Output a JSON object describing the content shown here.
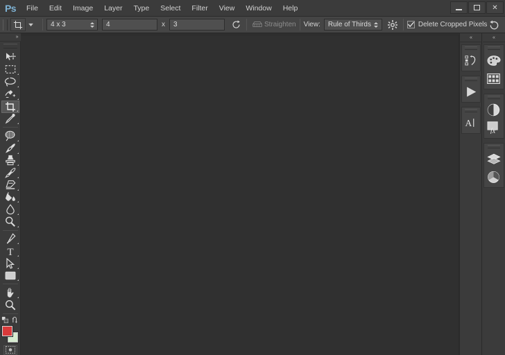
{
  "app": {
    "name": "Adobe Photoshop",
    "logo_text": "Ps"
  },
  "menubar": {
    "items": [
      {
        "label": "File",
        "name": "menu-file"
      },
      {
        "label": "Edit",
        "name": "menu-edit"
      },
      {
        "label": "Image",
        "name": "menu-image"
      },
      {
        "label": "Layer",
        "name": "menu-layer"
      },
      {
        "label": "Type",
        "name": "menu-type"
      },
      {
        "label": "Select",
        "name": "menu-select"
      },
      {
        "label": "Filter",
        "name": "menu-filter"
      },
      {
        "label": "View",
        "name": "menu-view"
      },
      {
        "label": "Window",
        "name": "menu-window"
      },
      {
        "label": "Help",
        "name": "menu-help"
      }
    ]
  },
  "window_controls": {
    "minimize": "minimize-button",
    "maximize": "maximize-button",
    "close_label": "✕"
  },
  "options_bar": {
    "tool": "crop-tool",
    "ratio_preset": "4 x 3",
    "width_value": "4",
    "separator_label": "x",
    "height_value": "3",
    "swap_icon": "swap-dimensions-icon",
    "straighten_label": "Straighten",
    "straighten_icon": "straighten-icon",
    "view_label": "View:",
    "overlay_value": "Rule of Thirds",
    "settings_icon": "gear-icon",
    "delete_cropped_label": "Delete Cropped Pixels",
    "delete_cropped_checked": true,
    "reset_icon": "reset-icon"
  },
  "toolbar": {
    "collapse_glyph": "»",
    "active_tool": "crop-tool",
    "groups": [
      {
        "tools": [
          {
            "name": "move-tool",
            "has_flyout": false
          },
          {
            "name": "rectangular-marquee-tool",
            "has_flyout": true
          },
          {
            "name": "lasso-tool",
            "has_flyout": true
          },
          {
            "name": "quick-selection-tool",
            "has_flyout": true
          },
          {
            "name": "crop-tool",
            "has_flyout": true,
            "active": true
          },
          {
            "name": "eyedropper-tool",
            "has_flyout": true
          }
        ]
      },
      {
        "tools": [
          {
            "name": "spot-healing-brush-tool",
            "has_flyout": true
          },
          {
            "name": "brush-tool",
            "has_flyout": true
          },
          {
            "name": "clone-stamp-tool",
            "has_flyout": true
          },
          {
            "name": "history-brush-tool",
            "has_flyout": true
          },
          {
            "name": "eraser-tool",
            "has_flyout": true
          },
          {
            "name": "gradient-tool",
            "has_flyout": true
          },
          {
            "name": "blur-tool",
            "has_flyout": true
          },
          {
            "name": "dodge-tool",
            "has_flyout": true
          }
        ]
      },
      {
        "tools": [
          {
            "name": "pen-tool",
            "has_flyout": true
          },
          {
            "name": "horizontal-type-tool",
            "has_flyout": true
          },
          {
            "name": "path-selection-tool",
            "has_flyout": true
          },
          {
            "name": "rectangle-tool",
            "has_flyout": true
          }
        ]
      },
      {
        "tools": [
          {
            "name": "hand-tool",
            "has_flyout": true
          },
          {
            "name": "zoom-tool",
            "has_flyout": false
          }
        ]
      }
    ],
    "color_controls": {
      "default_colors_icon": "default-colors-icon",
      "swap_colors_icon": "swap-colors-icon",
      "foreground_color": "#d93a3a",
      "background_color": "#d6ecd0",
      "quick_mask_icon": "quick-mask-icon"
    }
  },
  "canvas": {
    "background_color": "#303030",
    "name": "document-canvas"
  },
  "dock": {
    "collapse_glyph": "«",
    "columns": [
      {
        "name": "dock-column-inner",
        "groups": [
          {
            "icons": [
              {
                "name": "history-panel-icon"
              }
            ]
          },
          {
            "icons": [
              {
                "name": "actions-panel-icon"
              }
            ]
          },
          {
            "icons": [
              {
                "name": "character-panel-icon"
              }
            ]
          }
        ]
      },
      {
        "name": "dock-column-outer",
        "groups": [
          {
            "icons": [
              {
                "name": "color-panel-icon"
              },
              {
                "name": "swatches-panel-icon"
              }
            ]
          },
          {
            "icons": [
              {
                "name": "adjustments-panel-icon"
              },
              {
                "name": "styles-panel-icon"
              }
            ]
          },
          {
            "icons": [
              {
                "name": "layers-panel-icon"
              },
              {
                "name": "channels-panel-icon"
              }
            ]
          }
        ]
      }
    ]
  }
}
